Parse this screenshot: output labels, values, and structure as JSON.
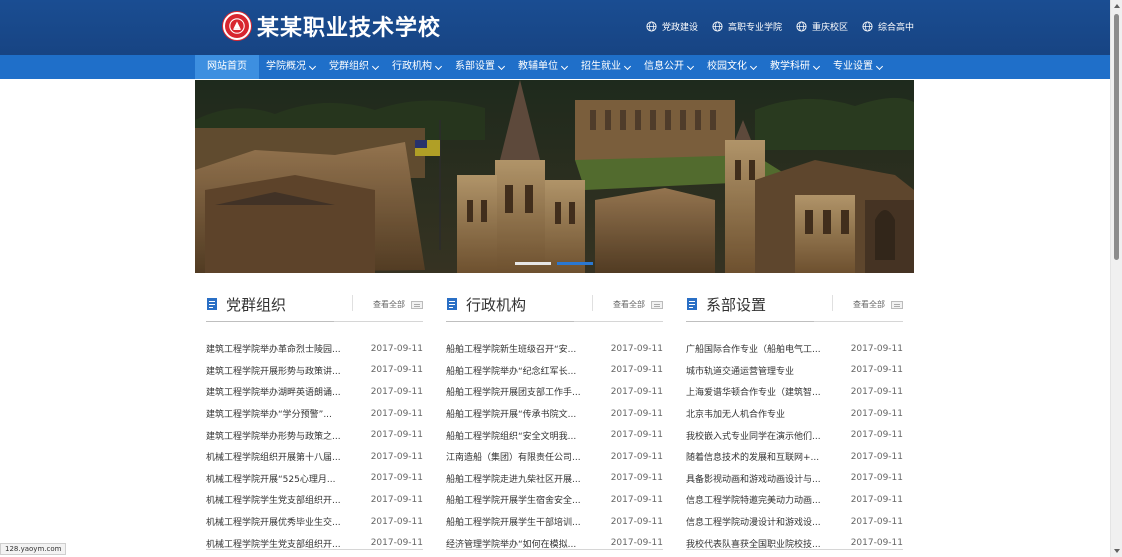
{
  "header": {
    "school_name": "某某职业技术学校",
    "quick_links": [
      "党政建设",
      "高职专业学院",
      "重庆校区",
      "综合高中"
    ]
  },
  "nav": {
    "items": [
      {
        "label": "网站首页",
        "active": true,
        "has_dropdown": false
      },
      {
        "label": "学院概况",
        "has_dropdown": true
      },
      {
        "label": "党群组织",
        "has_dropdown": true
      },
      {
        "label": "行政机构",
        "has_dropdown": true
      },
      {
        "label": "系部设置",
        "has_dropdown": true
      },
      {
        "label": "教辅单位",
        "has_dropdown": true
      },
      {
        "label": "招生就业",
        "has_dropdown": true
      },
      {
        "label": "信息公开",
        "has_dropdown": true
      },
      {
        "label": "校园文化",
        "has_dropdown": true
      },
      {
        "label": "教学科研",
        "has_dropdown": true
      },
      {
        "label": "专业设置",
        "has_dropdown": true
      }
    ]
  },
  "banner": {
    "slide_count": 2,
    "active_slide": 2
  },
  "columns": [
    {
      "title": "党群组织",
      "more": "查看全部",
      "items": [
        {
          "title": "建筑工程学院举办革命烈士陵园...",
          "date": "2017-09-11"
        },
        {
          "title": "建筑工程学院开展形势与政策讲...",
          "date": "2017-09-11"
        },
        {
          "title": "建筑工程学院举办湖畔英语朗诵...",
          "date": "2017-09-11"
        },
        {
          "title": "建筑工程学院举办“学分预警”...",
          "date": "2017-09-11"
        },
        {
          "title": "建筑工程学院举办形势与政策之...",
          "date": "2017-09-11"
        },
        {
          "title": "机械工程学院组织开展第十八届...",
          "date": "2017-09-11"
        },
        {
          "title": "机械工程学院开展“525心理月...",
          "date": "2017-09-11"
        },
        {
          "title": "机械工程学院学生党支部组织开...",
          "date": "2017-09-11"
        },
        {
          "title": "机械工程学院开展优秀毕业生交...",
          "date": "2017-09-11"
        },
        {
          "title": "机械工程学院学生党支部组织开...",
          "date": "2017-09-11"
        }
      ]
    },
    {
      "title": "行政机构",
      "more": "查看全部",
      "items": [
        {
          "title": "船舶工程学院新生班级召开“安...",
          "date": "2017-09-11"
        },
        {
          "title": "船舶工程学院举办“纪念红军长...",
          "date": "2017-09-11"
        },
        {
          "title": "船舶工程学院开展团支部工作手...",
          "date": "2017-09-11"
        },
        {
          "title": "船舶工程学院开展“传承书院文...",
          "date": "2017-09-11"
        },
        {
          "title": "船舶工程学院组织“安全文明我...",
          "date": "2017-09-11"
        },
        {
          "title": "江南造船（集团）有限责任公司...",
          "date": "2017-09-11"
        },
        {
          "title": "船舶工程学院走进九柴社区开展...",
          "date": "2017-09-11"
        },
        {
          "title": "船舶工程学院开展学生宿舍安全...",
          "date": "2017-09-11"
        },
        {
          "title": "船舶工程学院开展学生干部培训...",
          "date": "2017-09-11"
        },
        {
          "title": "经济管理学院举办“如何在模拟...",
          "date": "2017-09-11"
        }
      ]
    },
    {
      "title": "系部设置",
      "more": "查看全部",
      "items": [
        {
          "title": "广船国际合作专业（船舶电气工...",
          "date": "2017-09-11"
        },
        {
          "title": "城市轨道交通运营管理专业",
          "date": "2017-09-11"
        },
        {
          "title": "上海爱谱华顿合作专业（建筑智...",
          "date": "2017-09-11"
        },
        {
          "title": "北京韦加无人机合作专业",
          "date": "2017-09-11"
        },
        {
          "title": "我校嵌入式专业同学在演示他们...",
          "date": "2017-09-11"
        },
        {
          "title": "随着信息技术的发展和互联网+...",
          "date": "2017-09-11"
        },
        {
          "title": "具备影视动画和游戏动画设计与...",
          "date": "2017-09-11"
        },
        {
          "title": "信息工程学院特邀完美动力动画...",
          "date": "2017-09-11"
        },
        {
          "title": "信息工程学院动漫设计和游戏设...",
          "date": "2017-09-11"
        },
        {
          "title": "我校代表队喜获全国职业院校技...",
          "date": "2017-09-11"
        }
      ]
    }
  ],
  "status_bar": {
    "url": "128.yaoym.com"
  },
  "colors": {
    "header_bg": "#174483",
    "nav_bg": "#1f6fc9",
    "nav_active": "#3d8fe0",
    "logo_red": "#d8262f",
    "slider_active": "#2a78d2"
  }
}
